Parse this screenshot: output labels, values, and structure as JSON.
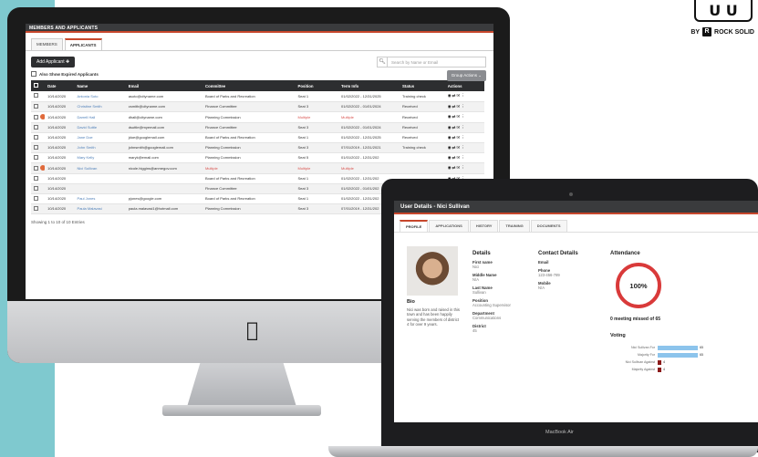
{
  "brand": {
    "logo_letters": "U U",
    "byline": "BY",
    "badge": "R",
    "company": "ROCK SOLID"
  },
  "desktop": {
    "header_title": "MEMBERS AND APPLICANTS",
    "tabs": [
      {
        "label": "MEMBERS"
      },
      {
        "label": "APPLICANTS"
      }
    ],
    "add_button": "Add Applicant ✚",
    "search_placeholder": "Search by Name or Email",
    "expired_checkbox_label": "Also Show Expired Applicants",
    "group_actions": "Group Actions ⌄",
    "columns": [
      "Date",
      "Name",
      "Email",
      "Committee",
      "Position",
      "Term Info",
      "Status",
      "Actions"
    ],
    "rows": [
      {
        "date": "10/14/2020",
        "name": "Antonia Soto",
        "email": "asoto@cityname.com",
        "committee": "Board of Parks and Recreation",
        "position": "Seat 1",
        "term": "01/02/2022 - 12/31/2025",
        "status": "Training check"
      },
      {
        "date": "10/14/2020",
        "name": "Christine Smith",
        "email": "csmith@cityname.com",
        "committee": "Finance Committee",
        "position": "Seat 3",
        "term": "01/02/2022 - 01/01/2024",
        "status": "Received"
      },
      {
        "date": "10/14/2020",
        "name": "Darrell Hall",
        "email": "dhall@cityname.com",
        "committee": "Planning Commission",
        "position": "Multiple",
        "term": "Multiple",
        "status": "Received"
      },
      {
        "date": "10/14/2020",
        "name": "David Suttle",
        "email": "dsuttle@myemail.com",
        "committee": "Finance Committee",
        "position": "Seat 3",
        "term": "01/02/2022 - 01/01/2024",
        "status": "Received"
      },
      {
        "date": "10/14/2020",
        "name": "Jane Doe",
        "email": "jdoe@googlemail.com",
        "committee": "Board of Parks and Recreation",
        "position": "Seat 1",
        "term": "01/02/2022 - 12/31/2025",
        "status": "Received"
      },
      {
        "date": "10/14/2020",
        "name": "John Smith",
        "email": "johnsmith@googlemail.com",
        "committee": "Planning Commission",
        "position": "Seat 3",
        "term": "07/01/2019 - 12/31/2021",
        "status": "Training check"
      },
      {
        "date": "10/14/2020",
        "name": "Mary Kelly",
        "email": "maryk@email.com",
        "committee": "Planning Commission",
        "position": "Seat 5",
        "term": "01/01/2022 - 12/31/202",
        "status": ""
      },
      {
        "date": "10/14/2020",
        "name": "Nici Sullivan",
        "email": "nicole.higgins@anmegov.com",
        "committee": "Multiple",
        "position": "Multiple",
        "term": "Multiple",
        "status": ""
      },
      {
        "date": "10/14/2020",
        "name": "",
        "email": "",
        "committee": "Board of Parks and Recreation",
        "position": "Seat 1",
        "term": "01/02/2022 - 12/31/202",
        "status": ""
      },
      {
        "date": "10/14/2020",
        "name": "",
        "email": "",
        "committee": "Finance Committee",
        "position": "Seat 3",
        "term": "01/02/2022 - 01/01/202",
        "status": ""
      },
      {
        "date": "10/14/2020",
        "name": "Paul Jones",
        "email": "pjones@google.com",
        "committee": "Board of Parks and Recreation",
        "position": "Seat 1",
        "term": "01/02/2022 - 12/31/202",
        "status": ""
      },
      {
        "date": "10/14/2020",
        "name": "Paula Malavasi",
        "email": "paula.malavasi1@hotmail.com",
        "committee": "Planning Commission",
        "position": "Seat 3",
        "term": "07/01/2019 - 12/31/202",
        "status": ""
      }
    ],
    "footer": "Showing 1 to 10 of 10 Entries"
  },
  "laptop": {
    "title": "User Details - Nici Sullivan",
    "tabs": [
      "PROFILE",
      "APPLICATIONS",
      "HISTORY",
      "TRAINING",
      "DOCUMENTS"
    ],
    "bio_title": "Bio",
    "bio_text": "Nici was born and raised in this town and has been happily serving the members of district 4 for over 9 years.",
    "details_title": "Details",
    "details": [
      {
        "label": "First name",
        "value": "Nici"
      },
      {
        "label": "Middle Name",
        "value": "N/A"
      },
      {
        "label": "Last Name",
        "value": "Sullivan"
      },
      {
        "label": "Position",
        "value": "Accounting Supervisor"
      },
      {
        "label": "Department",
        "value": "Communications"
      },
      {
        "label": "District",
        "value": "45"
      }
    ],
    "contact_title": "Contact Details",
    "contact": [
      {
        "label": "Email",
        "value": ""
      },
      {
        "label": "Phone",
        "value": "123-456-789"
      },
      {
        "label": "Mobile",
        "value": "N/A"
      }
    ],
    "attendance_title": "Attendance",
    "attendance_pct": "100%",
    "missed_text": "0 meeting missed of 65",
    "voting_title": "Voting",
    "votes": [
      {
        "label": "Nici Sullivan For",
        "value": 65,
        "max": 65,
        "color": "#8cc4ec"
      },
      {
        "label": "Majority For",
        "value": 65,
        "max": 65,
        "color": "#8cc4ec"
      },
      {
        "label": "Nici Sullivan Against",
        "value": 4,
        "max": 65,
        "color": "#8b1a1a"
      },
      {
        "label": "Majority Against",
        "value": 4,
        "max": 65,
        "color": "#8b1a1a"
      }
    ],
    "device_name": "MacBook Air"
  }
}
